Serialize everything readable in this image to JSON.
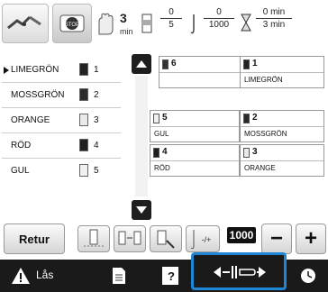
{
  "header": {
    "stitch_time_value": "3",
    "stitch_time_unit": "min",
    "color_counter_current": "0",
    "color_counter_total": "5",
    "stitch_counter_current": "0",
    "stitch_counter_total": "1000",
    "time_elapsed": "0 min",
    "time_total": "3 min"
  },
  "color_list": [
    {
      "name": "LIMEGRÖN",
      "index": "1",
      "color": "#222222",
      "selected": true
    },
    {
      "name": "MOSSGRÖN",
      "index": "2",
      "color": "#2a2a2a",
      "selected": false
    },
    {
      "name": "ORANGE",
      "index": "3",
      "color": "#eaeaea",
      "selected": false
    },
    {
      "name": "RÖD",
      "index": "4",
      "color": "#1f1f1f",
      "selected": false
    },
    {
      "name": "GUL",
      "index": "5",
      "color": "#f1f1f1",
      "selected": false
    }
  ],
  "spool_grid": [
    {
      "index": "6",
      "name": "",
      "color": "#333333"
    },
    {
      "index": "1",
      "name": "LIMEGRÖN",
      "color": "#222222"
    },
    {
      "index": "5",
      "name": "GUL",
      "color": "#f1f1f1"
    },
    {
      "index": "2",
      "name": "MOSSGRÖN",
      "color": "#2a2a2a"
    },
    {
      "index": "4",
      "name": "RÖD",
      "color": "#1f1f1f"
    },
    {
      "index": "3",
      "name": "ORANGE",
      "color": "#eaeaea"
    }
  ],
  "bottom": {
    "back_label": "Retur",
    "stitch_jump_value": "1000",
    "minus_label": "−",
    "plus_label": "+"
  },
  "taskbar": {
    "lock_label": "Lås"
  },
  "colors": {
    "highlight": "#1f86d6",
    "bar": "#1a1a1a"
  }
}
